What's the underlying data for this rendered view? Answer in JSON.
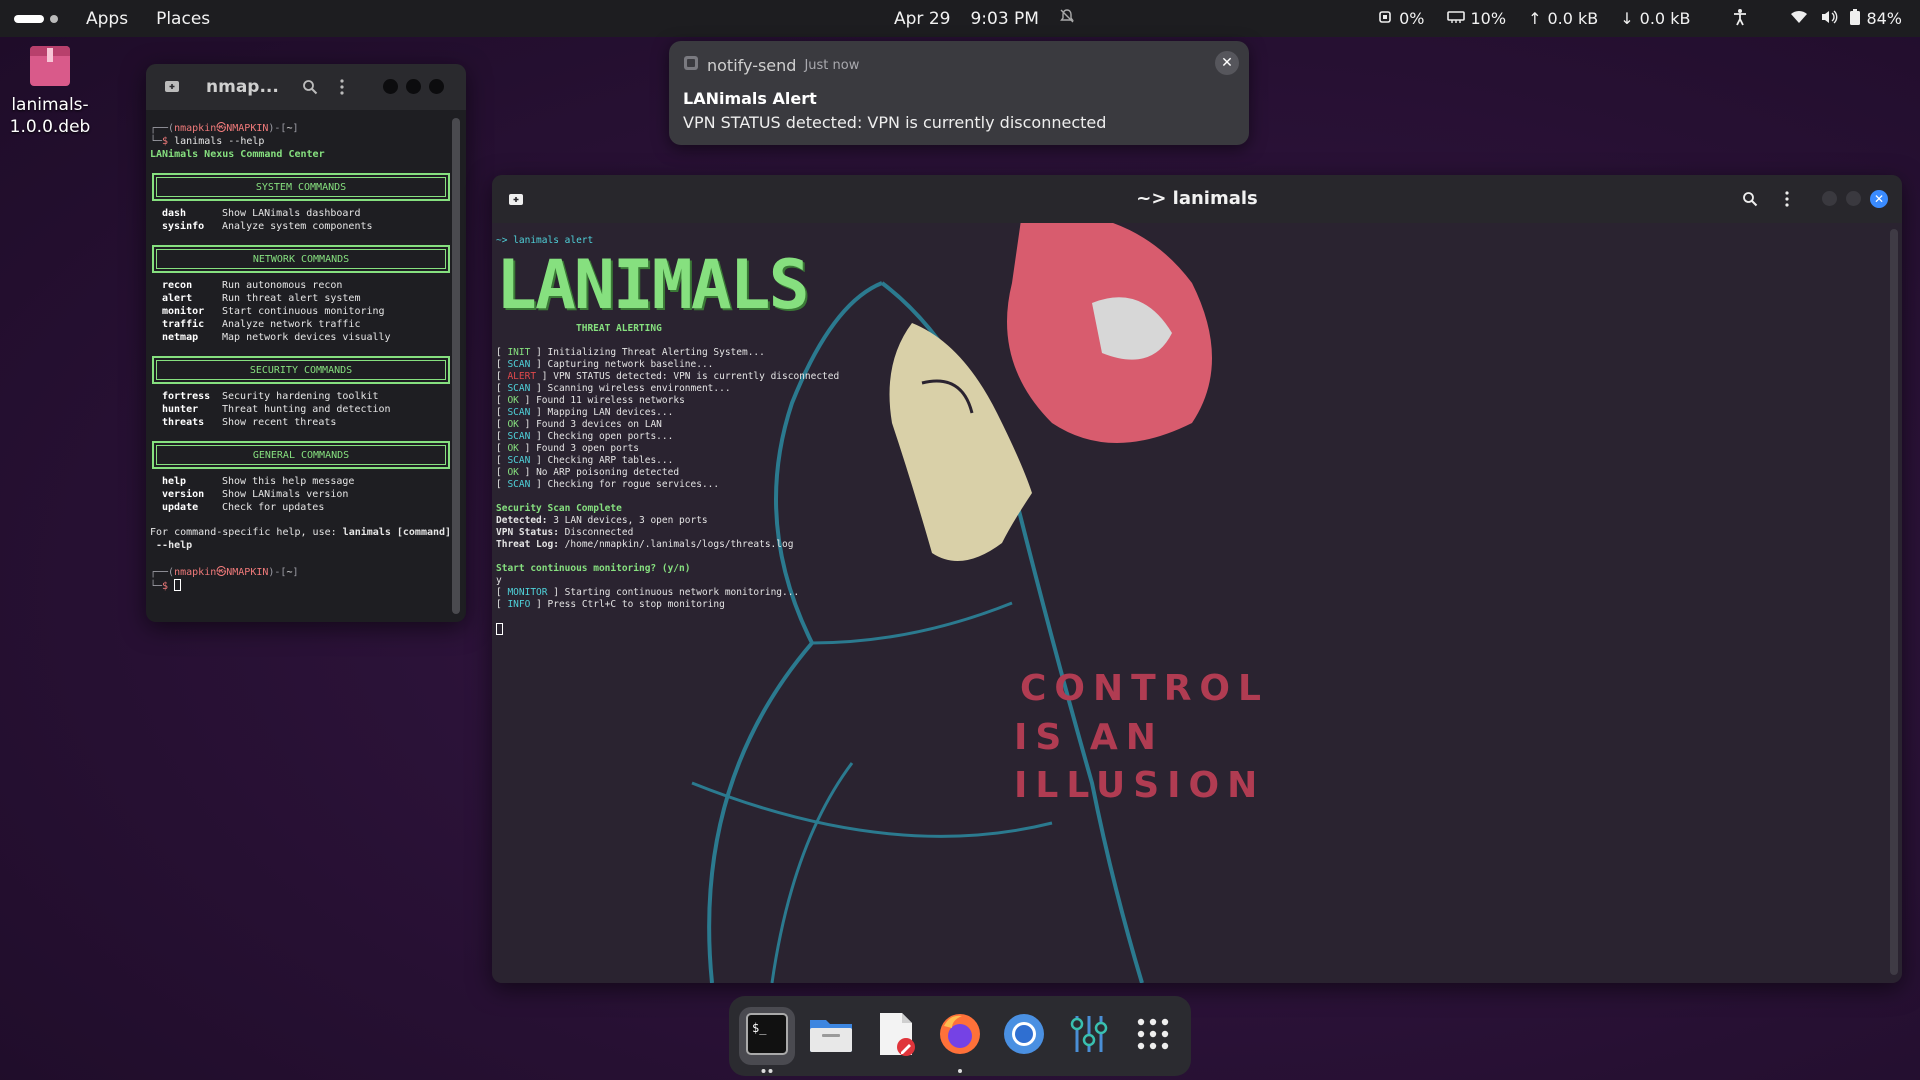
{
  "topbar": {
    "apps": "Apps",
    "places": "Places",
    "date": "Apr 29",
    "time": "9:03 PM",
    "cpu": "0%",
    "mem": "10%",
    "up": "0.0 kB",
    "down": "0.0 kB",
    "battery": "84%"
  },
  "desktop": {
    "file_label": "lanimals-1.0.0.deb"
  },
  "notification": {
    "app": "notify-send",
    "time": "Just now",
    "title": "LANimals Alert",
    "body": "VPN STATUS detected: VPN is currently disconnected"
  },
  "small_terminal": {
    "title": "nmap...",
    "prompt_user": "nmapkin㉿NMAPKIN",
    "prompt_dir": "~",
    "command": "lanimals --help",
    "header": "LANimals Nexus Command Center",
    "sections": [
      {
        "title": "SYSTEM COMMANDS",
        "commands": [
          {
            "name": "dash",
            "desc": "Show LANimals dashboard"
          },
          {
            "name": "sysinfo",
            "desc": "Analyze system components"
          }
        ]
      },
      {
        "title": "NETWORK COMMANDS",
        "commands": [
          {
            "name": "recon",
            "desc": "Run autonomous recon"
          },
          {
            "name": "alert",
            "desc": "Run threat alert system"
          },
          {
            "name": "monitor",
            "desc": "Start continuous monitoring"
          },
          {
            "name": "traffic",
            "desc": "Analyze network traffic"
          },
          {
            "name": "netmap",
            "desc": "Map network devices visually"
          }
        ]
      },
      {
        "title": "SECURITY COMMANDS",
        "commands": [
          {
            "name": "fortress",
            "desc": "Security hardening toolkit"
          },
          {
            "name": "hunter",
            "desc": "Threat hunting and detection"
          },
          {
            "name": "threats",
            "desc": "Show recent threats"
          }
        ]
      },
      {
        "title": "GENERAL COMMANDS",
        "commands": [
          {
            "name": "help",
            "desc": "Show this help message"
          },
          {
            "name": "version",
            "desc": "Show LANimals version"
          },
          {
            "name": "update",
            "desc": "Check for updates"
          }
        ]
      }
    ],
    "footer_prefix": "For command-specific help, use:",
    "footer_cmd": "lanimals [command]",
    "footer_suffix": "--help"
  },
  "large_terminal": {
    "title": "~> lanimals",
    "cmd_line": "~> lanimals alert",
    "logo": "LANIMALS",
    "subtitle": "THREAT ALERTING",
    "log": [
      {
        "tag": "INIT",
        "color": "green",
        "text": "Initializing Threat Alerting System..."
      },
      {
        "tag": "SCAN",
        "color": "cyan",
        "text": "Capturing network baseline..."
      },
      {
        "tag": "ALERT",
        "color": "red",
        "text": "VPN STATUS detected: VPN is currently disconnected"
      },
      {
        "tag": "SCAN",
        "color": "cyan",
        "text": "Scanning wireless environment..."
      },
      {
        "tag": "OK",
        "color": "green",
        "text": "Found 11 wireless networks"
      },
      {
        "tag": "SCAN",
        "color": "cyan",
        "text": "Mapping LAN devices..."
      },
      {
        "tag": "OK",
        "color": "green",
        "text": "Found 3 devices on LAN"
      },
      {
        "tag": "SCAN",
        "color": "cyan",
        "text": "Checking open ports..."
      },
      {
        "tag": "OK",
        "color": "green",
        "text": "Found 3 open ports"
      },
      {
        "tag": "SCAN",
        "color": "cyan",
        "text": "Checking ARP tables..."
      },
      {
        "tag": "OK",
        "color": "green",
        "text": "No ARP poisoning detected"
      },
      {
        "tag": "SCAN",
        "color": "cyan",
        "text": "Checking for rogue services..."
      }
    ],
    "summary_title": "Security Scan Complete",
    "detected_label": "Detected:",
    "detected_value": "3 LAN devices, 3 open ports",
    "vpn_label": "VPN Status:",
    "vpn_value": "Disconnected",
    "log_label": "Threat Log:",
    "log_value": "/home/nmapkin/.lanimals/logs/threats.log",
    "question": "Start continuous monitoring? (y/n)",
    "answer": "y",
    "monitor_tag": "MONITOR",
    "monitor_text": "Starting continuous network monitoring...",
    "info_tag": "INFO",
    "info_text": "Press Ctrl+C to stop monitoring",
    "wallpaper_text": [
      "CONTROL",
      "IS AN",
      "ILLUSION"
    ]
  },
  "dock": {
    "items": [
      "terminal-icon",
      "files-icon",
      "text-editor-icon",
      "firefox-icon",
      "chromium-icon",
      "settings-icon",
      "app-grid-icon"
    ]
  },
  "colors": {
    "accent_green": "#86e07f",
    "accent_cyan": "#4fd1d9",
    "alert_red": "#e0484b",
    "close_blue": "#3a8bff"
  }
}
